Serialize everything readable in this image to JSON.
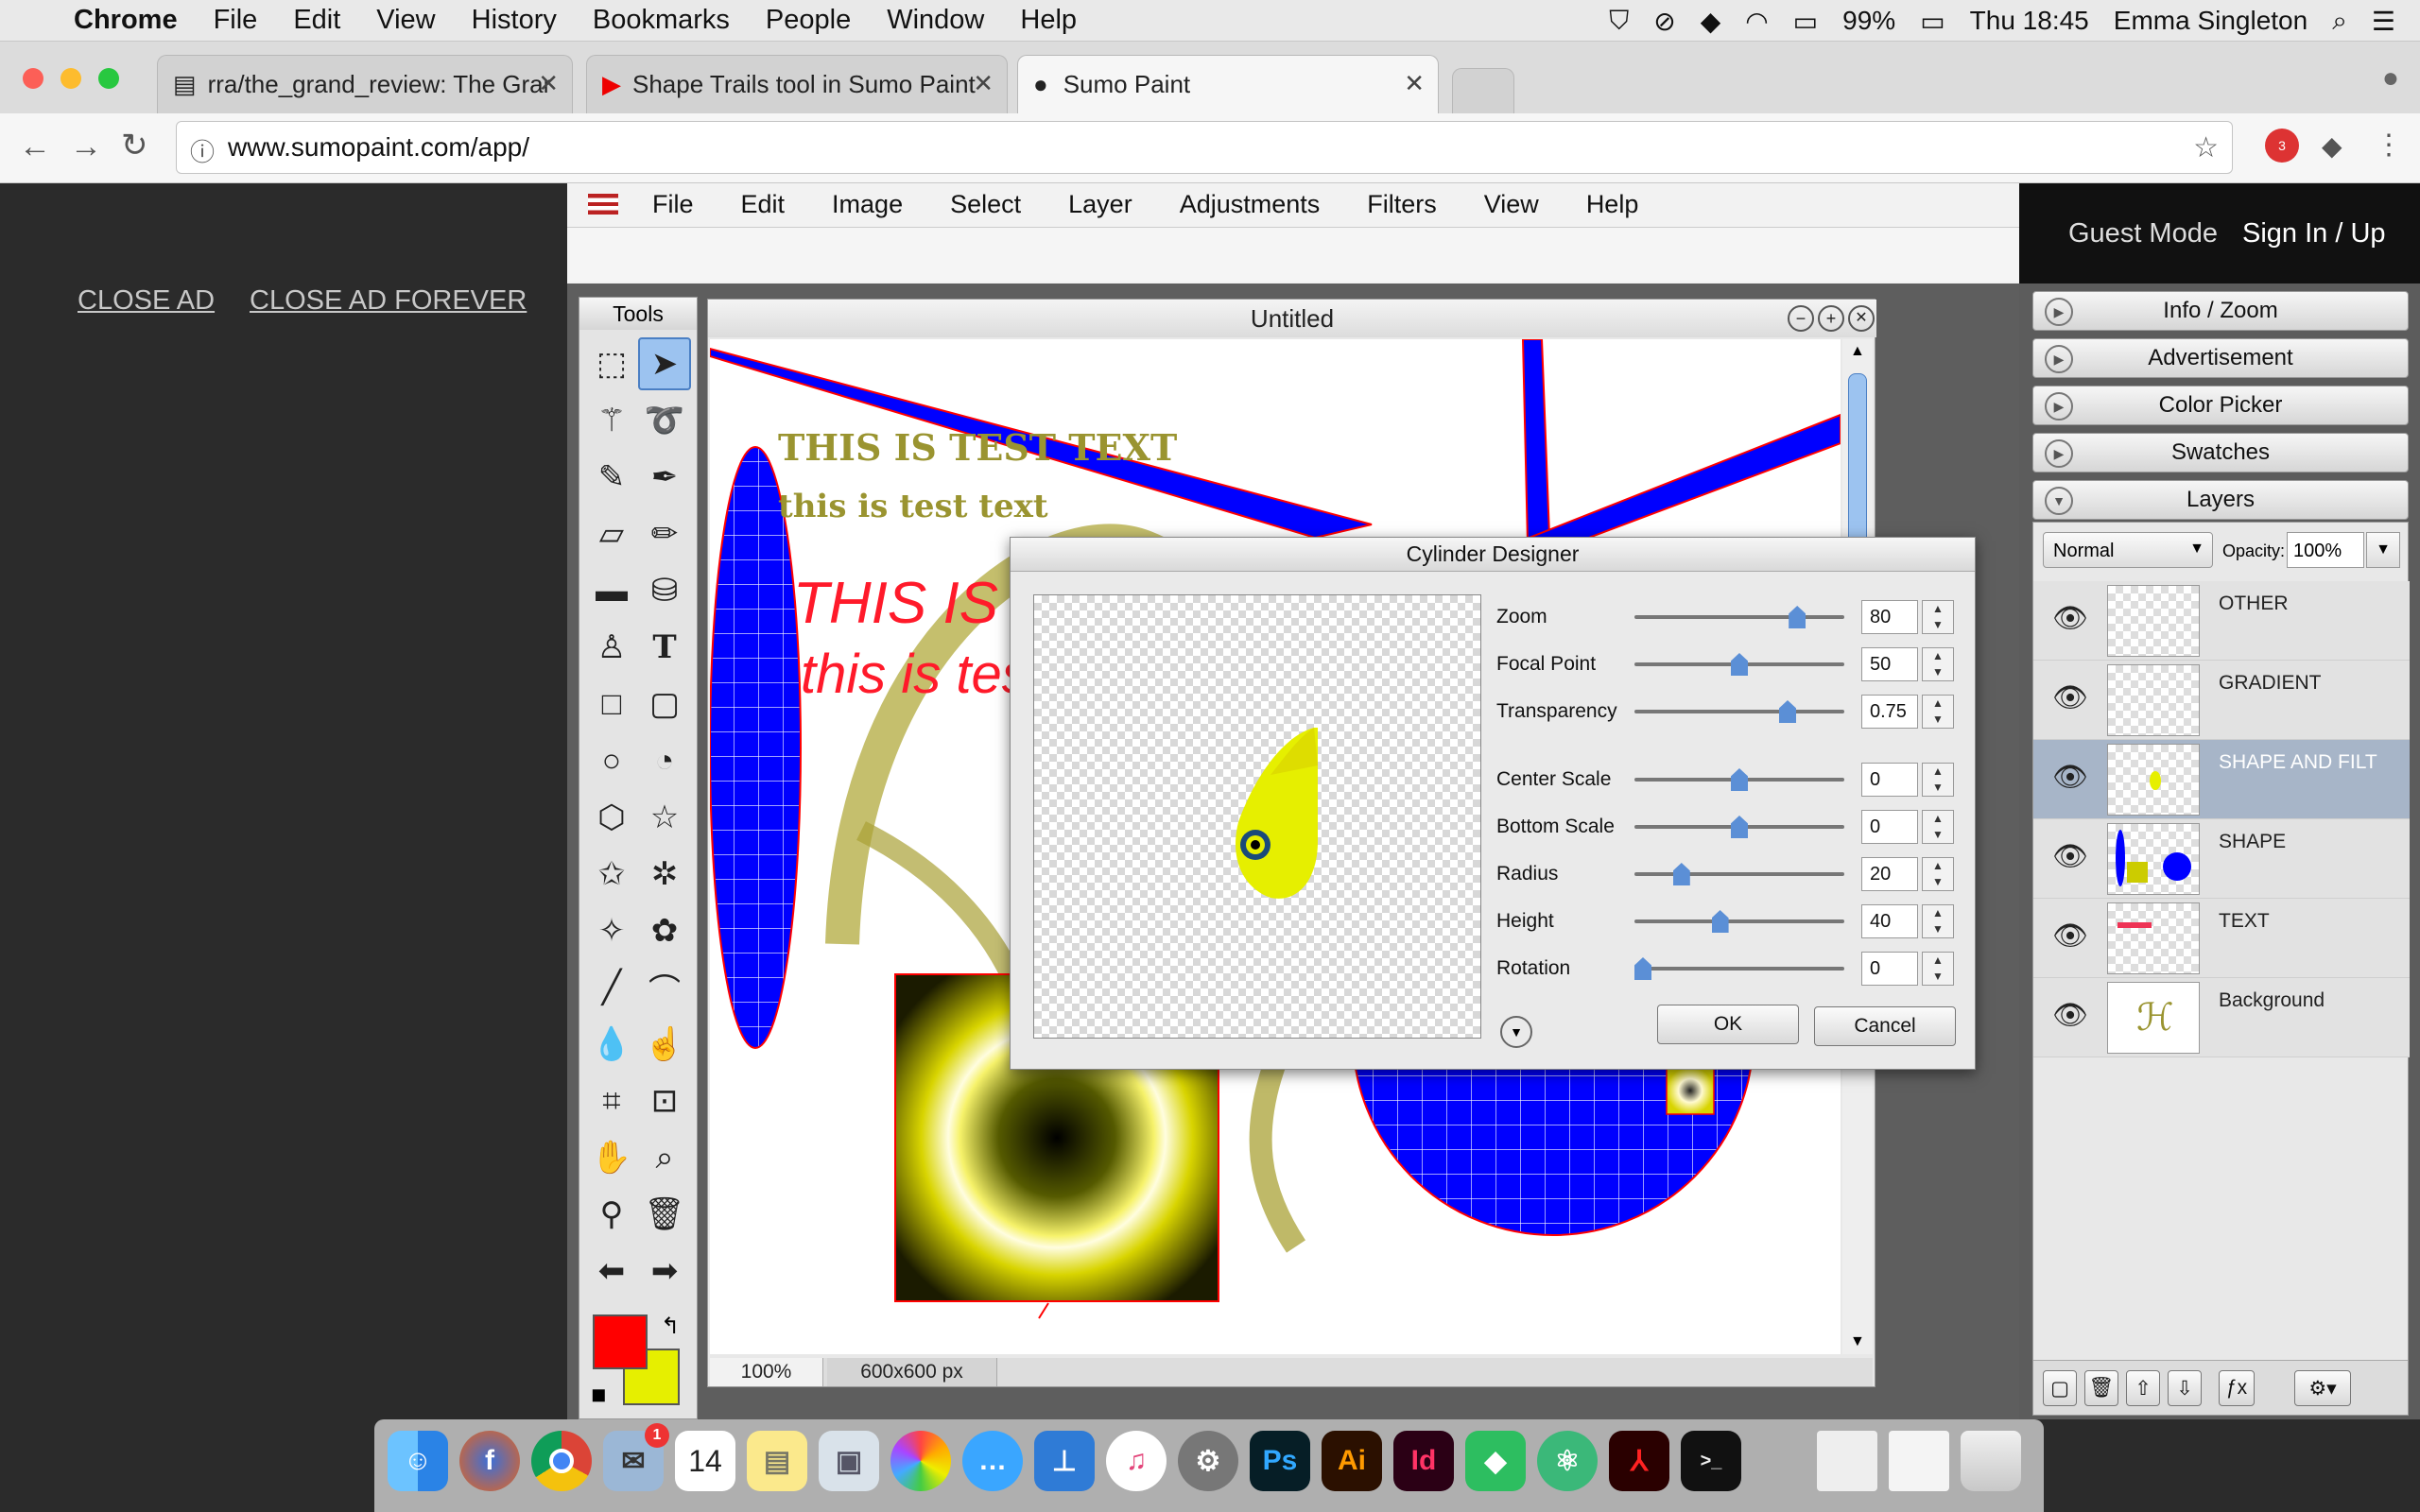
{
  "mac_menubar": {
    "app": "Chrome",
    "items": [
      "File",
      "Edit",
      "View",
      "History",
      "Bookmarks",
      "People",
      "Window",
      "Help"
    ],
    "battery": "99%",
    "clock": "Thu 18:45",
    "user": "Emma Singleton"
  },
  "browser": {
    "tabs": [
      {
        "label": "rra/the_grand_review: The Grar"
      },
      {
        "label": "Shape Trails tool in Sumo Paint"
      },
      {
        "label": "Sumo Paint"
      }
    ],
    "url": "www.sumopaint.com/app/",
    "extension_badge": "3"
  },
  "ad_area": {
    "close_ad": "CLOSE AD",
    "close_ad_forever": "CLOSE AD FOREVER"
  },
  "app_menu": [
    "File",
    "Edit",
    "Image",
    "Select",
    "Layer",
    "Adjustments",
    "Filters",
    "View",
    "Help"
  ],
  "account": {
    "guest": "Guest Mode",
    "signin": "Sign In / Up"
  },
  "tools_title": "Tools",
  "document": {
    "title": "Untitled",
    "zoom": "100%",
    "size": "600x600 px",
    "text_line1": "THIS IS TEST TEXT",
    "text_line2": "this is test text",
    "text_line3": "THIS IS",
    "text_line4": "this is tes"
  },
  "panels": [
    "Info / Zoom",
    "Advertisement",
    "Color Picker",
    "Swatches",
    "Layers"
  ],
  "layers": {
    "blend_mode": "Normal",
    "opacity_label": "Opacity:",
    "opacity": "100%",
    "items": [
      {
        "name": "OTHER"
      },
      {
        "name": "GRADIENT"
      },
      {
        "name": "SHAPE AND FILT",
        "selected": true
      },
      {
        "name": "SHAPE"
      },
      {
        "name": "TEXT"
      },
      {
        "name": "Background"
      }
    ]
  },
  "dialog": {
    "title": "Cylinder Designer",
    "params": [
      {
        "label": "Zoom",
        "value": "80",
        "level": 0.8
      },
      {
        "label": "Focal Point",
        "value": "50",
        "level": 0.5
      },
      {
        "label": "Transparency",
        "value": "0.75",
        "level": 0.75
      },
      {
        "label": "Center Scale",
        "value": "0",
        "level": 0.5
      },
      {
        "label": "Bottom Scale",
        "value": "0",
        "level": 0.5
      },
      {
        "label": "Radius",
        "value": "20",
        "level": 0.2
      },
      {
        "label": "Height",
        "value": "40",
        "level": 0.4
      },
      {
        "label": "Rotation",
        "value": "0",
        "level": 0.0
      }
    ],
    "ok": "OK",
    "cancel": "Cancel"
  },
  "colors": {
    "primary": "#ff0000",
    "secondary": "#e6ef00",
    "shape_blue": "#0000ff"
  },
  "dock": {
    "calendar_day": "14",
    "mail_badge": "1"
  }
}
